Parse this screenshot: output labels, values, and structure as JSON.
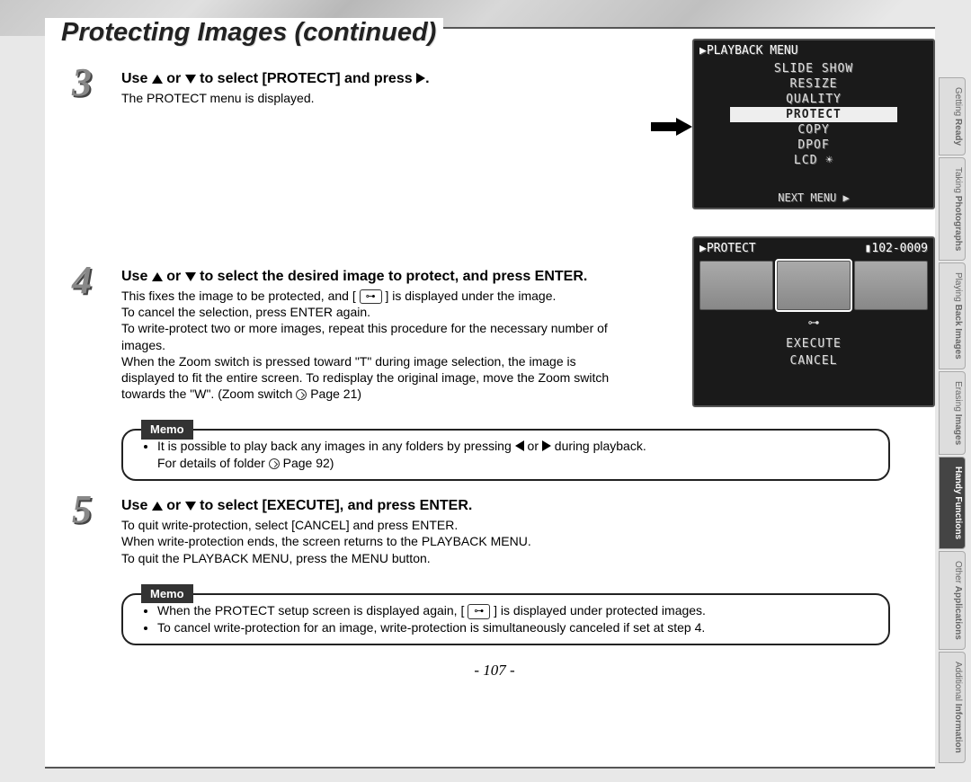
{
  "title": "Protecting Images (continued)",
  "page_number": "- 107 -",
  "steps": {
    "s3": {
      "num": "3",
      "title_a": "Use ",
      "title_b": " or ",
      "title_c": " to select [PROTECT] and press ",
      "title_d": ".",
      "text": "The PROTECT menu is displayed."
    },
    "s4": {
      "num": "4",
      "title_a": "Use ",
      "title_b": " or ",
      "title_c": " to select the desired image to protect, and press ENTER.",
      "line1a": "This fixes the image to be protected, and [ ",
      "line1b": " ] is displayed under the image.",
      "line2": "To cancel the selection, press ENTER again.",
      "line3": "To write-protect two or more images, repeat this procedure for the necessary number of images.",
      "line4": "When the Zoom switch is pressed toward \"T\" during image selection, the image is displayed to fit the entire screen. To redisplay the original image, move the Zoom switch towards the \"W\". (Zoom switch ",
      "line4b": " Page 21)"
    },
    "s5": {
      "num": "5",
      "title_a": "Use ",
      "title_b": " or ",
      "title_c": " to select [EXECUTE], and press ENTER.",
      "line1": "To quit write-protection, select [CANCEL] and press ENTER.",
      "line2": "When write-protection ends, the screen returns to the PLAYBACK MENU.",
      "line3": "To quit the PLAYBACK MENU, press the MENU button."
    }
  },
  "memo_label": "Memo",
  "memo1": {
    "bullet1a": "It is possible to play back any images in any folders by pressing ",
    "bullet1b": " or ",
    "bullet1c": " during playback.",
    "bullet2a": "For details of folder ",
    "bullet2b": " Page 92)"
  },
  "memo2": {
    "bullet1a": "When the PROTECT setup screen is displayed again, [ ",
    "bullet1b": " ] is displayed under protected images.",
    "bullet2": "To cancel write-protection for an image, write-protection is simultaneously canceled if set at step 4."
  },
  "screen1": {
    "header": "▶PLAYBACK MENU",
    "items": [
      "SLIDE SHOW",
      "RESIZE",
      "QUALITY",
      "PROTECT",
      "COPY",
      "DPOF",
      "LCD ☀"
    ],
    "selected_index": 3,
    "footer": "NEXT MENU ▶"
  },
  "screen2": {
    "header_left": "▶PROTECT",
    "header_right": "▮102-0009",
    "key_icon": "⊶",
    "items": [
      "EXECUTE",
      "CANCEL"
    ]
  },
  "side_tabs": [
    {
      "l1": "Getting",
      "l2": "Ready"
    },
    {
      "l1": "Taking",
      "l2": "Photographs"
    },
    {
      "l1": "Playing",
      "l2": "Back Images"
    },
    {
      "l1": "Erasing",
      "l2": "Images"
    },
    {
      "l1": "Handy",
      "l2": "Functions"
    },
    {
      "l1": "Other",
      "l2": "Applications"
    },
    {
      "l1": "Additional",
      "l2": "Information"
    }
  ],
  "active_tab_index": 4,
  "key_glyph": "⊶"
}
